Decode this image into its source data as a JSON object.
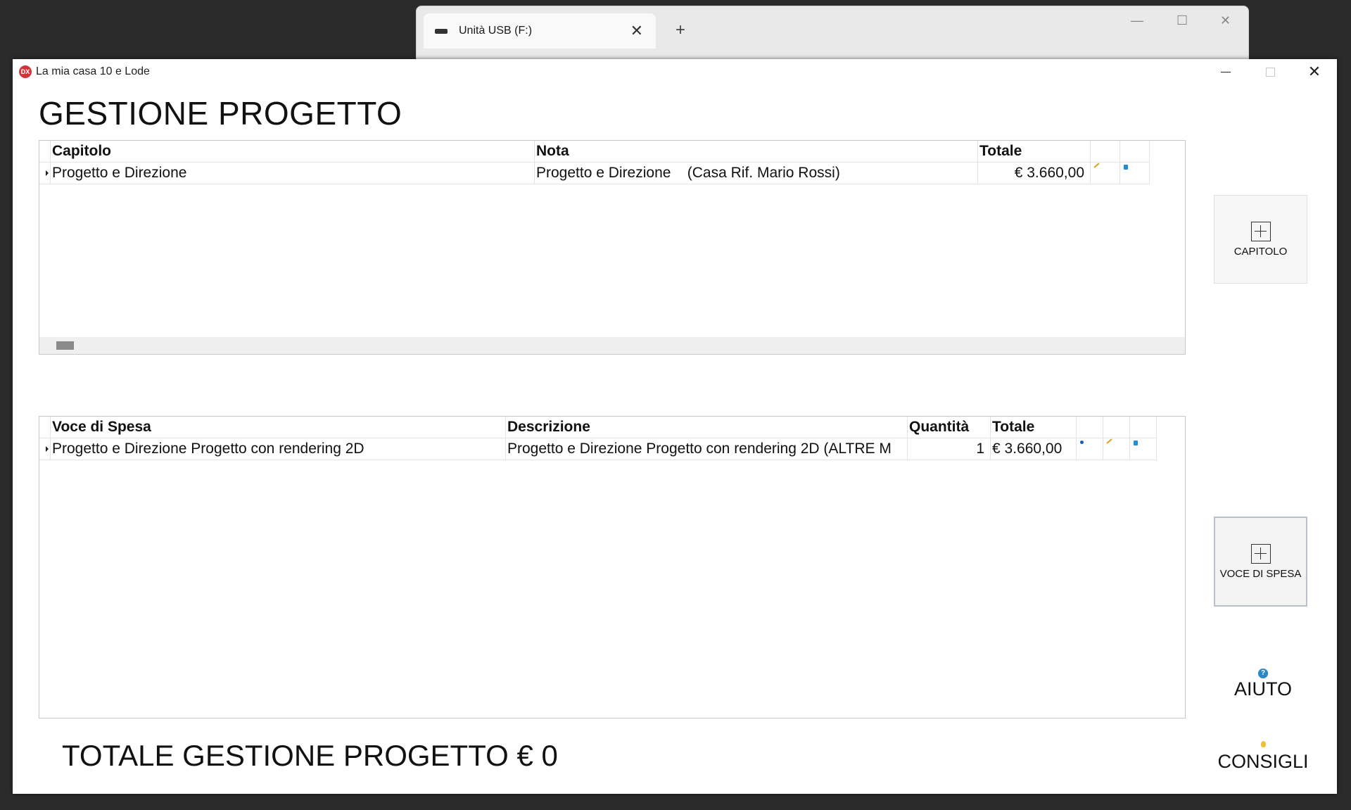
{
  "background_window": {
    "tab_title": "Unità USB (F:)"
  },
  "window": {
    "title": "La mia casa 10 e Lode",
    "logo": "DX"
  },
  "page_title": "GESTIONE PROGETTO",
  "capitoli_grid": {
    "headers": [
      "Capitolo",
      "Nota",
      "Totale"
    ],
    "rows": [
      {
        "capitolo": "Progetto e Direzione",
        "nota": "Progetto e Direzione    (Casa Rif. Mario Rossi)",
        "totale": "€ 3.660,00"
      }
    ]
  },
  "voci_grid": {
    "headers": [
      "Voce di Spesa",
      "Descrizione",
      "Quantità",
      "Totale"
    ],
    "rows": [
      {
        "voce": "Progetto e Direzione Progetto con rendering 2D",
        "descrizione": "Progetto e Direzione Progetto con rendering 2D (ALTRE M",
        "quantita": "1",
        "totale": "€ 3.660,00"
      }
    ]
  },
  "buttons": {
    "capitolo": "CAPITOLO",
    "voce_di_spesa": "VOCE DI SPESA",
    "aiuto": "AIUTO",
    "consigli": "CONSIGLI"
  },
  "total_label": "TOTALE GESTIONE PROGETTO € 0",
  "icons": {
    "edit": "pencil-icon",
    "delete": "trash-icon",
    "view": "eye-icon",
    "help": "question-icon",
    "tips": "bulb-icon"
  }
}
